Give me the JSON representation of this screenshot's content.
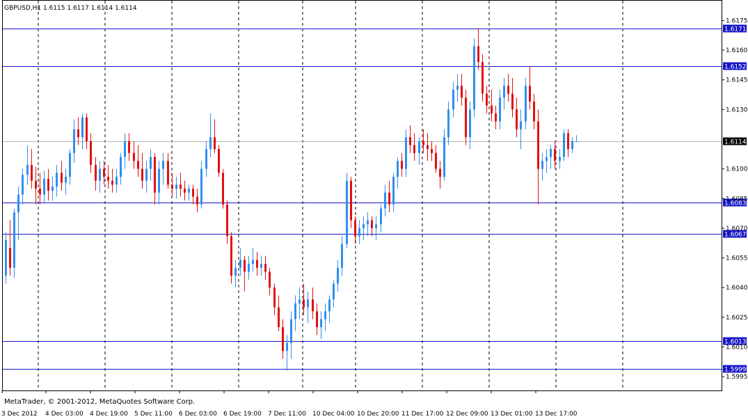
{
  "header": {
    "symbol_line": "GBPUSD,H1  1.6115 1.6117 1.6114 1.6114"
  },
  "footer": {
    "copyright": "MetaTrader, © 2001-2012, MetaQuotes Software Corp."
  },
  "colors": {
    "bull": "#2f8ff0",
    "bear": "#e01010",
    "hline": "#1414c8",
    "grid": "#000000",
    "price_label_bg": "#1414c8",
    "current_bg": "#000000"
  },
  "chart_data": {
    "type": "candlestick",
    "ylim": [
      1.5988,
      1.6185
    ],
    "y_ticks": [
      "1.6175",
      "1.6160",
      "1.6145",
      "1.6130",
      "1.6100",
      "1.6085",
      "1.6070",
      "1.6055",
      "1.6040",
      "1.6025",
      "1.6010",
      "1.5995"
    ],
    "x_labels": [
      "3 Dec 2012",
      "4 Dec 03:00",
      "4 Dec 19:00",
      "5 Dec 11:00",
      "6 Dec 03:00",
      "6 Dec 19:00",
      "7 Dec 11:00",
      "10 Dec 04:00",
      "10 Dec 20:00",
      "11 Dec 17:00",
      "12 Dec 09:00",
      "13 Dec 01:00",
      "13 Dec 17:00"
    ],
    "horizontal_levels": [
      "1.6171",
      "1.6152",
      "1.6083",
      "1.6067",
      "1.6013",
      "1.5999"
    ],
    "current_price": "1.6114",
    "ohlc": [
      [
        1.6046,
        1.6068,
        1.6042,
        1.6064
      ],
      [
        1.606,
        1.6074,
        1.6046,
        1.605
      ],
      [
        1.605,
        1.608,
        1.6045,
        1.6078
      ],
      [
        1.6078,
        1.6091,
        1.6064,
        1.6087
      ],
      [
        1.6087,
        1.61,
        1.6082,
        1.6097
      ],
      [
        1.6097,
        1.6112,
        1.6092,
        1.6102
      ],
      [
        1.6102,
        1.611,
        1.609,
        1.6094
      ],
      [
        1.6094,
        1.6101,
        1.6082,
        1.609
      ],
      [
        1.609,
        1.6098,
        1.6082,
        1.6087
      ],
      [
        1.6087,
        1.6099,
        1.6083,
        1.6095
      ],
      [
        1.6095,
        1.61,
        1.6084,
        1.6089
      ],
      [
        1.6089,
        1.6096,
        1.6084,
        1.6091
      ],
      [
        1.6091,
        1.6102,
        1.6086,
        1.6098
      ],
      [
        1.6098,
        1.6104,
        1.6089,
        1.6093
      ],
      [
        1.6093,
        1.61,
        1.6087,
        1.6096
      ],
      [
        1.6096,
        1.611,
        1.6092,
        1.6108
      ],
      [
        1.6108,
        1.6125,
        1.6103,
        1.612
      ],
      [
        1.612,
        1.6126,
        1.6112,
        1.6116
      ],
      [
        1.6116,
        1.6128,
        1.611,
        1.6126
      ],
      [
        1.6126,
        1.6128,
        1.611,
        1.6114
      ],
      [
        1.6114,
        1.6118,
        1.6098,
        1.6102
      ],
      [
        1.6102,
        1.6106,
        1.6089,
        1.6094
      ],
      [
        1.6094,
        1.6104,
        1.6088,
        1.61
      ],
      [
        1.61,
        1.6104,
        1.6092,
        1.6096
      ],
      [
        1.6096,
        1.6102,
        1.609,
        1.6094
      ],
      [
        1.6094,
        1.61,
        1.6088,
        1.6092
      ],
      [
        1.6092,
        1.61,
        1.6088,
        1.6096
      ],
      [
        1.6096,
        1.6108,
        1.6092,
        1.6106
      ],
      [
        1.6106,
        1.6118,
        1.61,
        1.6114
      ],
      [
        1.6114,
        1.6118,
        1.6104,
        1.6108
      ],
      [
        1.6108,
        1.6114,
        1.61,
        1.6104
      ],
      [
        1.6104,
        1.6112,
        1.6096,
        1.61
      ],
      [
        1.61,
        1.6108,
        1.609,
        1.6094
      ],
      [
        1.6094,
        1.6104,
        1.6088,
        1.61
      ],
      [
        1.61,
        1.611,
        1.6094,
        1.6106
      ],
      [
        1.6106,
        1.6108,
        1.6082,
        1.6088
      ],
      [
        1.6088,
        1.6104,
        1.6082,
        1.61
      ],
      [
        1.61,
        1.6108,
        1.6092,
        1.6104
      ],
      [
        1.6104,
        1.6108,
        1.609,
        1.6092
      ],
      [
        1.6092,
        1.6098,
        1.6086,
        1.609
      ],
      [
        1.609,
        1.6096,
        1.6085,
        1.6092
      ],
      [
        1.6092,
        1.6098,
        1.6086,
        1.609
      ],
      [
        1.609,
        1.6094,
        1.6084,
        1.6088
      ],
      [
        1.6088,
        1.6092,
        1.6084,
        1.609
      ],
      [
        1.609,
        1.6092,
        1.6082,
        1.6086
      ],
      [
        1.6086,
        1.609,
        1.6078,
        1.6082
      ],
      [
        1.6082,
        1.6104,
        1.608,
        1.61
      ],
      [
        1.61,
        1.6114,
        1.6096,
        1.611
      ],
      [
        1.611,
        1.6128,
        1.6106,
        1.6116
      ],
      [
        1.6116,
        1.6125,
        1.6108,
        1.611
      ],
      [
        1.611,
        1.6112,
        1.6096,
        1.6098
      ],
      [
        1.6098,
        1.61,
        1.608,
        1.6082
      ],
      [
        1.6082,
        1.6084,
        1.6062,
        1.6066
      ],
      [
        1.6066,
        1.6068,
        1.6042,
        1.6046
      ],
      [
        1.6046,
        1.6054,
        1.604,
        1.605
      ],
      [
        1.605,
        1.606,
        1.6046,
        1.6054
      ],
      [
        1.6054,
        1.6056,
        1.6038,
        1.6048
      ],
      [
        1.6048,
        1.6056,
        1.6044,
        1.6052
      ],
      [
        1.6052,
        1.606,
        1.6048,
        1.6054
      ],
      [
        1.6054,
        1.6058,
        1.6046,
        1.605
      ],
      [
        1.605,
        1.6056,
        1.6046,
        1.6052
      ],
      [
        1.6052,
        1.6056,
        1.6044,
        1.6048
      ],
      [
        1.6048,
        1.605,
        1.6036,
        1.604
      ],
      [
        1.604,
        1.6042,
        1.6026,
        1.603
      ],
      [
        1.603,
        1.6036,
        1.6018,
        1.602
      ],
      [
        1.602,
        1.6024,
        1.6004,
        1.6008
      ],
      [
        1.6008,
        1.6016,
        1.5998,
        1.6012
      ],
      [
        1.6012,
        1.6028,
        1.6004,
        1.6024
      ],
      [
        1.6024,
        1.6036,
        1.6018,
        1.6032
      ],
      [
        1.6032,
        1.604,
        1.6024,
        1.6034
      ],
      [
        1.6034,
        1.6042,
        1.6026,
        1.603
      ],
      [
        1.603,
        1.6038,
        1.6022,
        1.6034
      ],
      [
        1.6034,
        1.604,
        1.6024,
        1.6028
      ],
      [
        1.6028,
        1.6032,
        1.6016,
        1.602
      ],
      [
        1.602,
        1.6028,
        1.6014,
        1.6024
      ],
      [
        1.6024,
        1.6032,
        1.6018,
        1.6028
      ],
      [
        1.6028,
        1.6036,
        1.6022,
        1.6034
      ],
      [
        1.6034,
        1.6044,
        1.603,
        1.6042
      ],
      [
        1.6042,
        1.6054,
        1.6038,
        1.605
      ],
      [
        1.605,
        1.6066,
        1.6046,
        1.6062
      ],
      [
        1.6062,
        1.6098,
        1.606,
        1.6094
      ],
      [
        1.6094,
        1.6096,
        1.607,
        1.6074
      ],
      [
        1.6074,
        1.6076,
        1.6062,
        1.6066
      ],
      [
        1.6066,
        1.6074,
        1.6062,
        1.607
      ],
      [
        1.607,
        1.6076,
        1.6064,
        1.6072
      ],
      [
        1.6072,
        1.6078,
        1.6066,
        1.6074
      ],
      [
        1.6074,
        1.6076,
        1.6066,
        1.607
      ],
      [
        1.607,
        1.6076,
        1.6064,
        1.6072
      ],
      [
        1.6072,
        1.6082,
        1.6068,
        1.608
      ],
      [
        1.608,
        1.6092,
        1.6076,
        1.6088
      ],
      [
        1.6088,
        1.6094,
        1.6078,
        1.6082
      ],
      [
        1.6082,
        1.6098,
        1.6078,
        1.6096
      ],
      [
        1.6096,
        1.6106,
        1.609,
        1.6104
      ],
      [
        1.6104,
        1.6108,
        1.6096,
        1.61
      ],
      [
        1.61,
        1.612,
        1.6096,
        1.6116
      ],
      [
        1.6116,
        1.6122,
        1.6108,
        1.6112
      ],
      [
        1.6112,
        1.6118,
        1.6104,
        1.6108
      ],
      [
        1.6108,
        1.6116,
        1.6102,
        1.6114
      ],
      [
        1.6114,
        1.612,
        1.6108,
        1.6112
      ],
      [
        1.6112,
        1.6118,
        1.6104,
        1.611
      ],
      [
        1.611,
        1.6114,
        1.6104,
        1.6108
      ],
      [
        1.6108,
        1.6112,
        1.6098,
        1.61
      ],
      [
        1.61,
        1.6104,
        1.609,
        1.6096
      ],
      [
        1.6096,
        1.612,
        1.6094,
        1.6116
      ],
      [
        1.6116,
        1.6134,
        1.6112,
        1.613
      ],
      [
        1.613,
        1.6144,
        1.6126,
        1.614
      ],
      [
        1.614,
        1.6148,
        1.6134,
        1.6142
      ],
      [
        1.6142,
        1.6148,
        1.6132,
        1.6136
      ],
      [
        1.6136,
        1.614,
        1.6112,
        1.6116
      ],
      [
        1.6116,
        1.6134,
        1.611,
        1.613
      ],
      [
        1.613,
        1.6166,
        1.6126,
        1.6162
      ],
      [
        1.6162,
        1.6171,
        1.615,
        1.6154
      ],
      [
        1.6154,
        1.6158,
        1.6134,
        1.6138
      ],
      [
        1.6138,
        1.6142,
        1.6128,
        1.6132
      ],
      [
        1.6132,
        1.614,
        1.6124,
        1.6128
      ],
      [
        1.6128,
        1.6132,
        1.612,
        1.6124
      ],
      [
        1.6124,
        1.614,
        1.612,
        1.6136
      ],
      [
        1.6136,
        1.6146,
        1.613,
        1.6142
      ],
      [
        1.6142,
        1.6148,
        1.6134,
        1.6138
      ],
      [
        1.6138,
        1.6146,
        1.6126,
        1.613
      ],
      [
        1.613,
        1.6136,
        1.6116,
        1.612
      ],
      [
        1.612,
        1.613,
        1.611,
        1.6124
      ],
      [
        1.6124,
        1.6146,
        1.612,
        1.6142
      ],
      [
        1.6142,
        1.6152,
        1.613,
        1.6134
      ],
      [
        1.6134,
        1.6138,
        1.612,
        1.6124
      ],
      [
        1.6124,
        1.613,
        1.6082,
        1.61
      ],
      [
        1.61,
        1.6108,
        1.6094,
        1.6104
      ],
      [
        1.6104,
        1.611,
        1.6098,
        1.6106
      ],
      [
        1.6106,
        1.6112,
        1.61,
        1.611
      ],
      [
        1.611,
        1.6114,
        1.61,
        1.6104
      ],
      [
        1.6104,
        1.611,
        1.61,
        1.6106
      ],
      [
        1.6106,
        1.612,
        1.6104,
        1.6118
      ],
      [
        1.6118,
        1.612,
        1.6106,
        1.611
      ],
      [
        1.611,
        1.6116,
        1.6108,
        1.6114
      ],
      [
        1.6114,
        1.6117,
        1.6114,
        1.6114
      ]
    ]
  }
}
